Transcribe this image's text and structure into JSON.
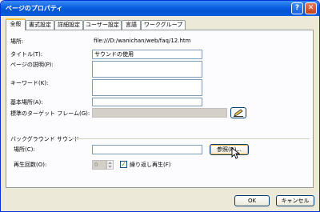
{
  "window": {
    "title": "ページのプロパティ",
    "help_label": "?",
    "close_label": "✕"
  },
  "tabs": [
    {
      "label": "全般"
    },
    {
      "label": "書式設定"
    },
    {
      "label": "詳細設定"
    },
    {
      "label": "ユーザー設定"
    },
    {
      "label": "言語"
    },
    {
      "label": "ワークグループ"
    }
  ],
  "fields": {
    "location_label": "場所:",
    "location_value": "file:///D:/wanichan/web/faq/12.htm",
    "title_label": "タイトル(T):",
    "title_value": "サウンドの使用",
    "description_label": "ページの説明(P):",
    "description_value": "",
    "keywords_label": "キーワード(K):",
    "keywords_value": "",
    "base_location_label": "基本場所(A):",
    "base_location_value": "",
    "target_frame_label": "標準のターゲット フレーム(G):",
    "target_frame_value": ""
  },
  "sound": {
    "group_label": "バックグラウンド サウンド",
    "location_label": "場所(C):",
    "location_value": "",
    "browse_label": "参照(R)...",
    "loop_label": "再生回数(O):",
    "loop_value": "0",
    "forever_label": "繰り返し再生(F)",
    "forever_checked": true
  },
  "footer": {
    "ok_label": "OK",
    "cancel_label": "キャンセル"
  },
  "icons": {
    "pencil": "pencil-icon",
    "cursor": "mouse-cursor-icon",
    "spinner": "spinner-arrows-icon"
  }
}
